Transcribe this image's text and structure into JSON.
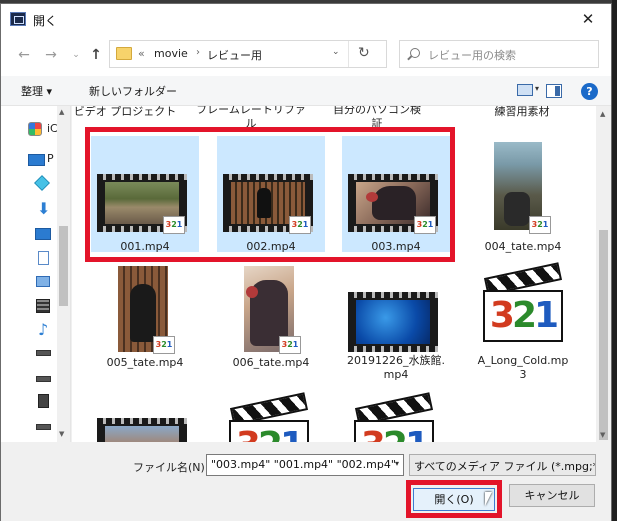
{
  "window": {
    "title": "開く",
    "close_glyph": "✕"
  },
  "nav": {
    "back_glyph": "←",
    "forward_glyph": "→",
    "recent_glyph": "⌄",
    "up_glyph": "↑",
    "breadcrumb_prefix": "«",
    "breadcrumb": [
      "movie",
      "レビュー用"
    ],
    "breadcrumb_sep": "›",
    "address_dropdown_glyph": "⌄",
    "refresh_glyph": "↻",
    "search_placeholder": "レビュー用の検索"
  },
  "toolbar": {
    "organize_label": "整理 ▾",
    "new_folder_label": "新しいフォルダー",
    "view_dropdown_glyph": "▾",
    "help_label": "?"
  },
  "sidebar": {
    "items": [
      {
        "icon": "onedrive-icon",
        "label": "iC"
      },
      {
        "icon": "pc-icon",
        "label": "P"
      },
      {
        "icon": "3d-objects-icon",
        "label": ""
      },
      {
        "icon": "downloads-icon",
        "label": ""
      },
      {
        "icon": "desktop-icon",
        "label": ""
      },
      {
        "icon": "documents-icon",
        "label": ""
      },
      {
        "icon": "pictures-icon",
        "label": ""
      },
      {
        "icon": "videos-icon",
        "label": ""
      },
      {
        "icon": "music-icon",
        "label": ""
      },
      {
        "icon": "drive-icon",
        "label": ""
      },
      {
        "icon": "drive-icon",
        "label": ""
      },
      {
        "icon": "drive-icon",
        "label": ""
      },
      {
        "icon": "drive-icon",
        "label": ""
      }
    ]
  },
  "cut_labels": [
    "ビデオ プロジェクト",
    "フレームレートリファ\nル",
    "自分のパソコン検\n証",
    "練習用素材"
  ],
  "files": [
    {
      "name": "001.mp4",
      "selected": true
    },
    {
      "name": "002.mp4",
      "selected": true
    },
    {
      "name": "003.mp4",
      "selected": true
    },
    {
      "name": "004_tate.mp4",
      "selected": false
    },
    {
      "name": "005_tate.mp4",
      "selected": false
    },
    {
      "name": "006_tate.mp4",
      "selected": false
    },
    {
      "name": "20191226_水族館.\nmp4",
      "selected": false
    },
    {
      "name": "A_Long_Cold.mp\n3",
      "selected": false
    }
  ],
  "badge": {
    "d3": "3",
    "d2": "2",
    "d1": "1"
  },
  "footer": {
    "filename_label": "ファイル名(N):",
    "filename_value": "\"003.mp4\" \"001.mp4\" \"002.mp4\"",
    "filename_dropdown_glyph": "▾",
    "filetype_value": "すべてのメディア ファイル (*.mpg;*.m",
    "open_label": "開く(O)",
    "cancel_label": "キャンセル"
  },
  "colors": {
    "selection": "#cce8ff",
    "highlight_box": "#e3142a",
    "accent": "#1b6ac9"
  }
}
